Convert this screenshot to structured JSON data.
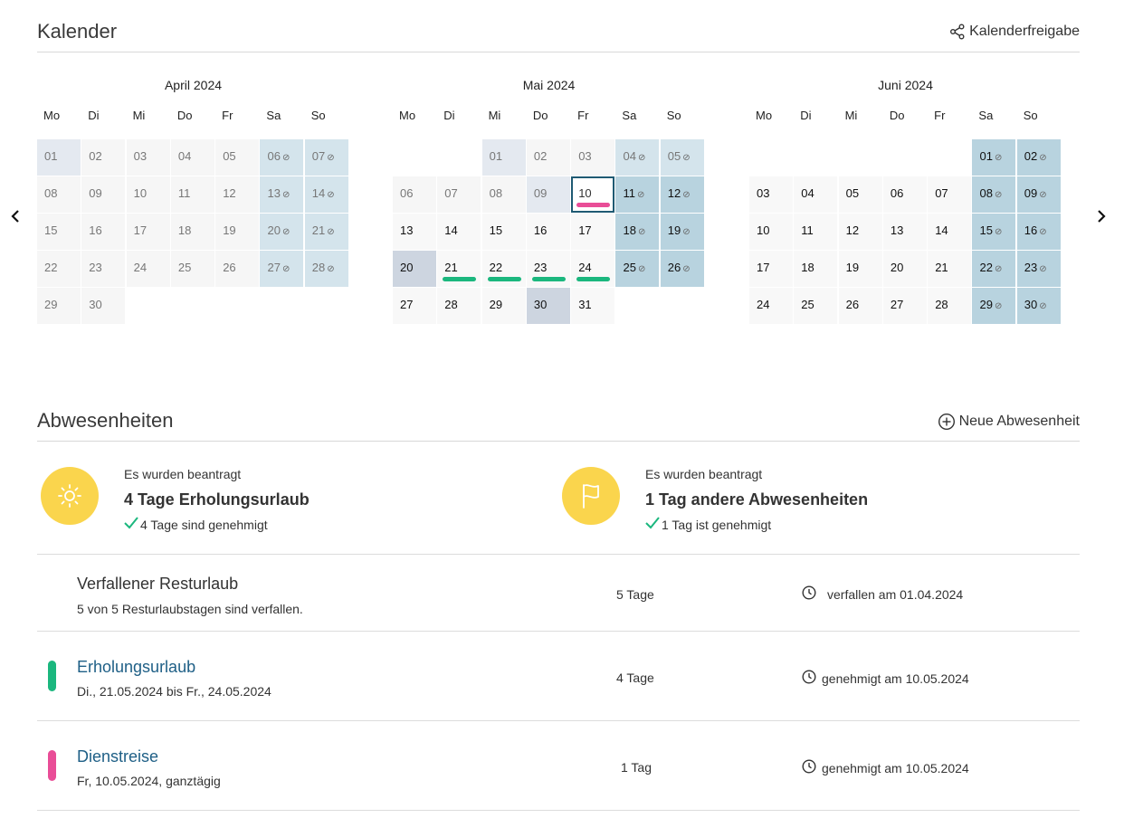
{
  "calendar": {
    "title": "Kalender",
    "share_label": "Kalenderfreigabe",
    "weekdays": [
      "Mo",
      "Di",
      "Mi",
      "Do",
      "Fr",
      "Sa",
      "So"
    ],
    "months": [
      {
        "title": "April 2024",
        "cells": [
          {
            "d": "01",
            "s": "blue-light"
          },
          {
            "d": "02",
            "s": "past"
          },
          {
            "d": "03",
            "s": "past"
          },
          {
            "d": "04",
            "s": "past"
          },
          {
            "d": "05",
            "s": "past"
          },
          {
            "d": "06",
            "s": "pastwe",
            "blocked": true
          },
          {
            "d": "07",
            "s": "pastwe",
            "blocked": true
          },
          {
            "d": "08",
            "s": "past"
          },
          {
            "d": "09",
            "s": "past"
          },
          {
            "d": "10",
            "s": "past"
          },
          {
            "d": "11",
            "s": "past"
          },
          {
            "d": "12",
            "s": "past"
          },
          {
            "d": "13",
            "s": "pastwe",
            "blocked": true
          },
          {
            "d": "14",
            "s": "pastwe",
            "blocked": true
          },
          {
            "d": "15",
            "s": "past"
          },
          {
            "d": "16",
            "s": "past"
          },
          {
            "d": "17",
            "s": "past"
          },
          {
            "d": "18",
            "s": "past"
          },
          {
            "d": "19",
            "s": "past"
          },
          {
            "d": "20",
            "s": "pastwe",
            "blocked": true
          },
          {
            "d": "21",
            "s": "pastwe",
            "blocked": true
          },
          {
            "d": "22",
            "s": "past"
          },
          {
            "d": "23",
            "s": "past"
          },
          {
            "d": "24",
            "s": "past"
          },
          {
            "d": "25",
            "s": "past"
          },
          {
            "d": "26",
            "s": "past"
          },
          {
            "d": "27",
            "s": "pastwe",
            "blocked": true
          },
          {
            "d": "28",
            "s": "pastwe",
            "blocked": true
          },
          {
            "d": "29",
            "s": "past"
          },
          {
            "d": "30",
            "s": "past"
          },
          {
            "d": "",
            "s": "empty"
          },
          {
            "d": "",
            "s": "empty"
          },
          {
            "d": "",
            "s": "empty"
          },
          {
            "d": "",
            "s": "empty"
          },
          {
            "d": "",
            "s": "empty"
          }
        ]
      },
      {
        "title": "Mai 2024",
        "cells": [
          {
            "d": "",
            "s": "empty"
          },
          {
            "d": "",
            "s": "empty"
          },
          {
            "d": "01",
            "s": "blue-light"
          },
          {
            "d": "02",
            "s": "past"
          },
          {
            "d": "03",
            "s": "past"
          },
          {
            "d": "04",
            "s": "pastwe",
            "blocked": true
          },
          {
            "d": "05",
            "s": "pastwe",
            "blocked": true
          },
          {
            "d": "06",
            "s": "past"
          },
          {
            "d": "07",
            "s": "past"
          },
          {
            "d": "08",
            "s": "past"
          },
          {
            "d": "09",
            "s": "blue-light"
          },
          {
            "d": "10",
            "s": "today",
            "bar": "pink"
          },
          {
            "d": "11",
            "s": "we",
            "blocked": true
          },
          {
            "d": "12",
            "s": "we",
            "blocked": true
          },
          {
            "d": "13",
            "s": "wd-norm"
          },
          {
            "d": "14",
            "s": "wd-norm"
          },
          {
            "d": "15",
            "s": "wd-norm"
          },
          {
            "d": "16",
            "s": "wd-norm"
          },
          {
            "d": "17",
            "s": "wd-norm"
          },
          {
            "d": "18",
            "s": "we",
            "blocked": true
          },
          {
            "d": "19",
            "s": "we",
            "blocked": true
          },
          {
            "d": "20",
            "s": "holiday"
          },
          {
            "d": "21",
            "s": "wd-norm",
            "bar": "green"
          },
          {
            "d": "22",
            "s": "wd-norm",
            "bar": "green"
          },
          {
            "d": "23",
            "s": "wd-norm",
            "bar": "green"
          },
          {
            "d": "24",
            "s": "wd-norm",
            "bar": "green"
          },
          {
            "d": "25",
            "s": "we",
            "blocked": true
          },
          {
            "d": "26",
            "s": "we",
            "blocked": true
          },
          {
            "d": "27",
            "s": "wd-norm"
          },
          {
            "d": "28",
            "s": "wd-norm"
          },
          {
            "d": "29",
            "s": "wd-norm"
          },
          {
            "d": "30",
            "s": "holiday"
          },
          {
            "d": "31",
            "s": "wd-norm"
          },
          {
            "d": "",
            "s": "empty"
          },
          {
            "d": "",
            "s": "empty"
          }
        ]
      },
      {
        "title": "Juni 2024",
        "cells": [
          {
            "d": "",
            "s": "empty"
          },
          {
            "d": "",
            "s": "empty"
          },
          {
            "d": "",
            "s": "empty"
          },
          {
            "d": "",
            "s": "empty"
          },
          {
            "d": "",
            "s": "empty"
          },
          {
            "d": "01",
            "s": "we",
            "blocked": true
          },
          {
            "d": "02",
            "s": "we",
            "blocked": true
          },
          {
            "d": "03",
            "s": "wd-norm"
          },
          {
            "d": "04",
            "s": "wd-norm"
          },
          {
            "d": "05",
            "s": "wd-norm"
          },
          {
            "d": "06",
            "s": "wd-norm"
          },
          {
            "d": "07",
            "s": "wd-norm"
          },
          {
            "d": "08",
            "s": "we",
            "blocked": true
          },
          {
            "d": "09",
            "s": "we",
            "blocked": true
          },
          {
            "d": "10",
            "s": "wd-norm"
          },
          {
            "d": "11",
            "s": "wd-norm"
          },
          {
            "d": "12",
            "s": "wd-norm"
          },
          {
            "d": "13",
            "s": "wd-norm"
          },
          {
            "d": "14",
            "s": "wd-norm"
          },
          {
            "d": "15",
            "s": "we",
            "blocked": true
          },
          {
            "d": "16",
            "s": "we",
            "blocked": true
          },
          {
            "d": "17",
            "s": "wd-norm"
          },
          {
            "d": "18",
            "s": "wd-norm"
          },
          {
            "d": "19",
            "s": "wd-norm"
          },
          {
            "d": "20",
            "s": "wd-norm"
          },
          {
            "d": "21",
            "s": "wd-norm"
          },
          {
            "d": "22",
            "s": "we",
            "blocked": true
          },
          {
            "d": "23",
            "s": "we",
            "blocked": true
          },
          {
            "d": "24",
            "s": "wd-norm"
          },
          {
            "d": "25",
            "s": "wd-norm"
          },
          {
            "d": "26",
            "s": "wd-norm"
          },
          {
            "d": "27",
            "s": "wd-norm"
          },
          {
            "d": "28",
            "s": "wd-norm"
          },
          {
            "d": "29",
            "s": "we",
            "blocked": true
          },
          {
            "d": "30",
            "s": "we",
            "blocked": true
          }
        ]
      }
    ]
  },
  "absences": {
    "title": "Abwesenheiten",
    "new_label": "Neue Abwesenheit",
    "summary_vacation": {
      "small": "Es wurden beantragt",
      "big": "4 Tage Erholungsurlaub",
      "ok": "4 Tage sind genehmigt"
    },
    "summary_other": {
      "small": "Es wurden beantragt",
      "big": "1 Tag andere Abwesenheiten",
      "ok": "1 Tag ist genehmigt"
    },
    "rows": [
      {
        "title": "Verfallener Resturlaub",
        "sub": "5 von 5 Resturlaubstagen sind verfallen.",
        "amount": "5 Tage",
        "status": "verfallen am  01.04.2024"
      },
      {
        "title": "Erholungsurlaub",
        "sub": "Di., 21.05.2024 bis Fr., 24.05.2024",
        "amount": "4 Tage",
        "status": "genehmigt am 10.05.2024"
      },
      {
        "title": "Dienstreise",
        "sub": "Fr, 10.05.2024, ganztägig",
        "amount": "1 Tag",
        "status": "genehmigt am 10.05.2024"
      }
    ]
  },
  "colors": {
    "green": "#1bb77e",
    "pink": "#e94d97",
    "link": "#1e5f86",
    "summary_icon_bg": "#fad54d"
  }
}
